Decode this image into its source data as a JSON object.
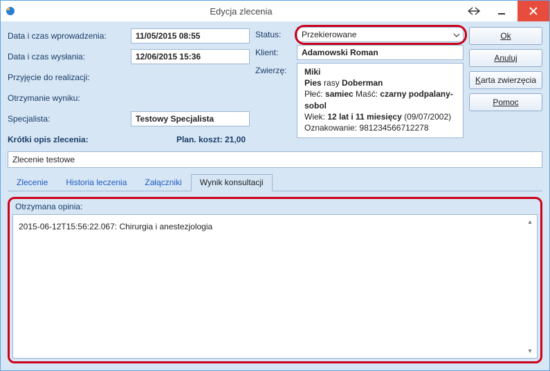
{
  "window": {
    "title": "Edycja zlecenia"
  },
  "form": {
    "date_entered_label": "Data i czas wprowadzenia:",
    "date_entered_value": "11/05/2015 08:55",
    "date_sent_label": "Data i czas wysłania:",
    "date_sent_value": "12/06/2015 15:36",
    "accepted_label": "Przyjęcie do realizacji:",
    "result_received_label": "Otrzymanie wyniku:",
    "specialist_label": "Specjalista:",
    "specialist_value": "Testowy Specjalista",
    "plan_cost_label": "Plan. koszt: 21,00",
    "short_desc_label": "Krótki opis zlecenia:",
    "short_desc_value": "Zlecenie testowe",
    "status_label": "Status:",
    "status_value": "Przekierowane",
    "client_label": "Klient:",
    "client_value": "Adamowski Roman",
    "animal_label": "Zwierzę:",
    "animal": {
      "name": "Miki",
      "species_prefix": "Pies",
      "species_middle": " rasy ",
      "breed": "Doberman",
      "sex_label": "Płeć: ",
      "sex_value": "samiec",
      "color_label": "  Maść: ",
      "color_value": "czarny podpalany-sobol",
      "age_label": "Wiek: ",
      "age_value": "12 lat i 11 miesięcy",
      "age_date": " (09/07/2002)",
      "marking_label": "Oznakowanie: ",
      "marking_value": "981234566712278"
    }
  },
  "buttons": {
    "ok": "Ok",
    "cancel": "Anuluj",
    "animal_card_pre": "K",
    "animal_card_post": "arta zwierzęcia",
    "help": "Pomoc"
  },
  "tabs": {
    "order": "Zlecenie",
    "history": "Historia leczenia",
    "attachments": "Załączniki",
    "result": "Wynik konsultacji"
  },
  "pane": {
    "title": "Otrzymana opinia:",
    "content": "2015-06-12T15:56:22.067: Chirurgia i anestezjologia"
  }
}
